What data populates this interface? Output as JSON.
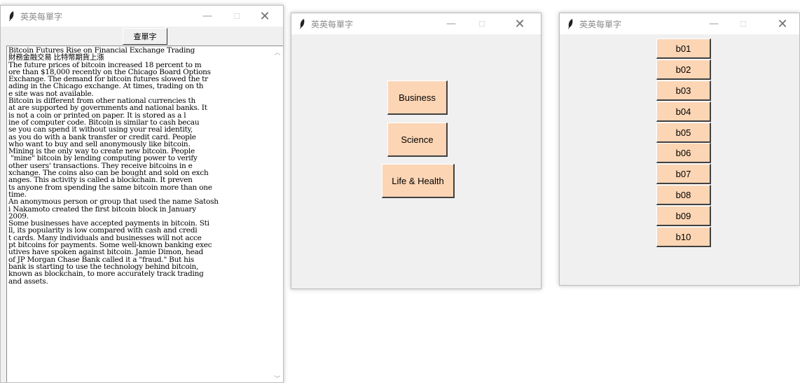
{
  "windows": {
    "reader": {
      "title": "英英每單字",
      "lookup_button": "查單字",
      "article_lines": [
        "Bitcoin Futures Rise on Financial Exchange Trading",
        "財務金融交易 比特幣期貨上漲",
        "The future prices of bitcoin increased 18 percent to m",
        "ore than $18,000 recently on the Chicago Board Options",
        "Exchange. The demand for bitcoin futures slowed the tr",
        "ading in the Chicago exchange. At times, trading on th",
        "e site was not available.",
        "Bitcoin is different from other national currencies th",
        "at are supported by governments and national banks. It",
        "is not a coin or printed on paper. It is stored as a l",
        "ine of computer code. Bitcoin is similar to cash becau",
        "se you can spend it without using your real identity,",
        "as you do with a bank transfer or credit card. People",
        "who want to buy and sell anonymously like bitcoin.",
        "Mining is the only way to create new bitcoin. People",
        " \"mine\" bitcoin by lending computing power to verify",
        "other users' transactions. They receive bitcoins in e",
        "xchange. The coins also can be bought and sold on exch",
        "anges. This activity is called a blockchain. It preven",
        "ts anyone from spending the same bitcoin more than one",
        "time.",
        "An anonymous person or group that used the name Satosh",
        "i Nakamoto created the first bitcoin block in January",
        "2009.",
        "Some businesses have accepted payments in bitcoin. Sti",
        "ll, its popularity is low compared with cash and credi",
        "t cards. Many individuals and businesses will not acce",
        "pt bitcoins for payments. Some well-known banking exec",
        "utives have spoken against bitcoin. Jamie Dimon, head",
        "of JP Morgan Chase Bank called it a \"fraud.\" But his",
        "bank is starting to use the technology behind bitcoin,",
        "known as blockchain, to more accurately track trading",
        "and assets."
      ]
    },
    "categories": {
      "title": "英英每單字",
      "buttons": [
        "Business",
        "Science",
        "Life & Health"
      ]
    },
    "words": {
      "title": "英英每單字",
      "buttons": [
        "b01",
        "b02",
        "b03",
        "b04",
        "b05",
        "b06",
        "b07",
        "b08",
        "b09",
        "b10"
      ]
    }
  },
  "controls": {
    "minimize": "—",
    "maximize": "☐",
    "close": "✕"
  },
  "colors": {
    "button_fill": "#fcd5b4",
    "window_bg": "#f0f0f0",
    "title_text": "#8a8a8a"
  }
}
